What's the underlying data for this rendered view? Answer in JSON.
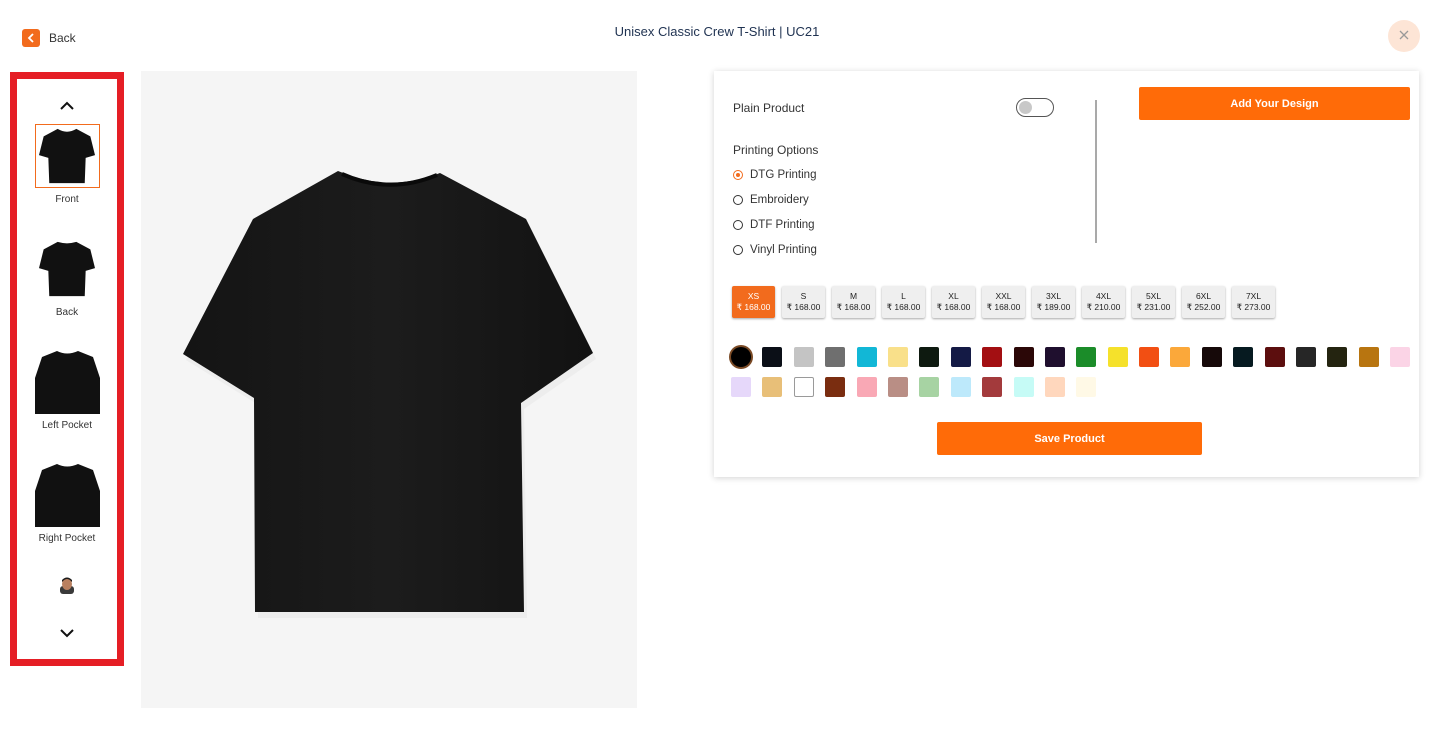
{
  "header": {
    "back_label": "Back",
    "title": "Unisex Classic Crew T-Shirt | UC21"
  },
  "icons": {
    "back": "chevron-left-icon",
    "close": "close-icon",
    "rail_up": "chevron-up-icon",
    "rail_down": "chevron-down-icon"
  },
  "thumbnails": [
    {
      "label": "Front",
      "selected": true
    },
    {
      "label": "Back",
      "selected": false
    },
    {
      "label": "Left Pocket",
      "selected": false
    },
    {
      "label": "Right Pocket",
      "selected": false
    },
    {
      "label": "",
      "selected": false
    }
  ],
  "options": {
    "plain_product_label": "Plain Product",
    "plain_product_on": false,
    "add_design_label": "Add Your Design",
    "printing_title": "Printing Options",
    "printing_options": [
      {
        "label": "DTG Printing",
        "checked": true
      },
      {
        "label": "Embroidery",
        "checked": false
      },
      {
        "label": "DTF Printing",
        "checked": false
      },
      {
        "label": "Vinyl Printing",
        "checked": false
      }
    ],
    "sizes": [
      {
        "name": "XS",
        "price": "₹ 168.00",
        "active": true
      },
      {
        "name": "S",
        "price": "₹ 168.00",
        "active": false
      },
      {
        "name": "M",
        "price": "₹ 168.00",
        "active": false
      },
      {
        "name": "L",
        "price": "₹ 168.00",
        "active": false
      },
      {
        "name": "XL",
        "price": "₹ 168.00",
        "active": false
      },
      {
        "name": "XXL",
        "price": "₹ 168.00",
        "active": false
      },
      {
        "name": "3XL",
        "price": "₹ 189.00",
        "active": false
      },
      {
        "name": "4XL",
        "price": "₹ 210.00",
        "active": false
      },
      {
        "name": "5XL",
        "price": "₹ 231.00",
        "active": false
      },
      {
        "name": "6XL",
        "price": "₹ 252.00",
        "active": false
      },
      {
        "name": "7XL",
        "price": "₹ 273.00",
        "active": false
      }
    ],
    "colors": [
      "#000000",
      "#0b0f17",
      "#c4c4c4",
      "#6f6f6f",
      "#12b7d6",
      "#f9e08a",
      "#0e1a10",
      "#141a45",
      "#a30f12",
      "#2b0707",
      "#1f0f2e",
      "#1b8c29",
      "#f5e12b",
      "#f24f13",
      "#fba83a",
      "#160909",
      "#061a20",
      "#5c0e0e",
      "#262626",
      "#242410",
      "#b87510",
      "#fbd4e6",
      "#e6d8fa",
      "#e8bf78",
      "#ffffff",
      "#7a2d10",
      "#f9a8b5",
      "#b98e85",
      "#a7d3a3",
      "#bde9fb",
      "#a33a3c",
      "#c6fbf6",
      "#ffd7bd",
      "#fff9e6"
    ],
    "selected_color": "#000000",
    "save_label": "Save Product"
  },
  "colors": {
    "accent": "#ff6b08",
    "sidebar_border": "#e51e25",
    "title": "#1f3251"
  }
}
